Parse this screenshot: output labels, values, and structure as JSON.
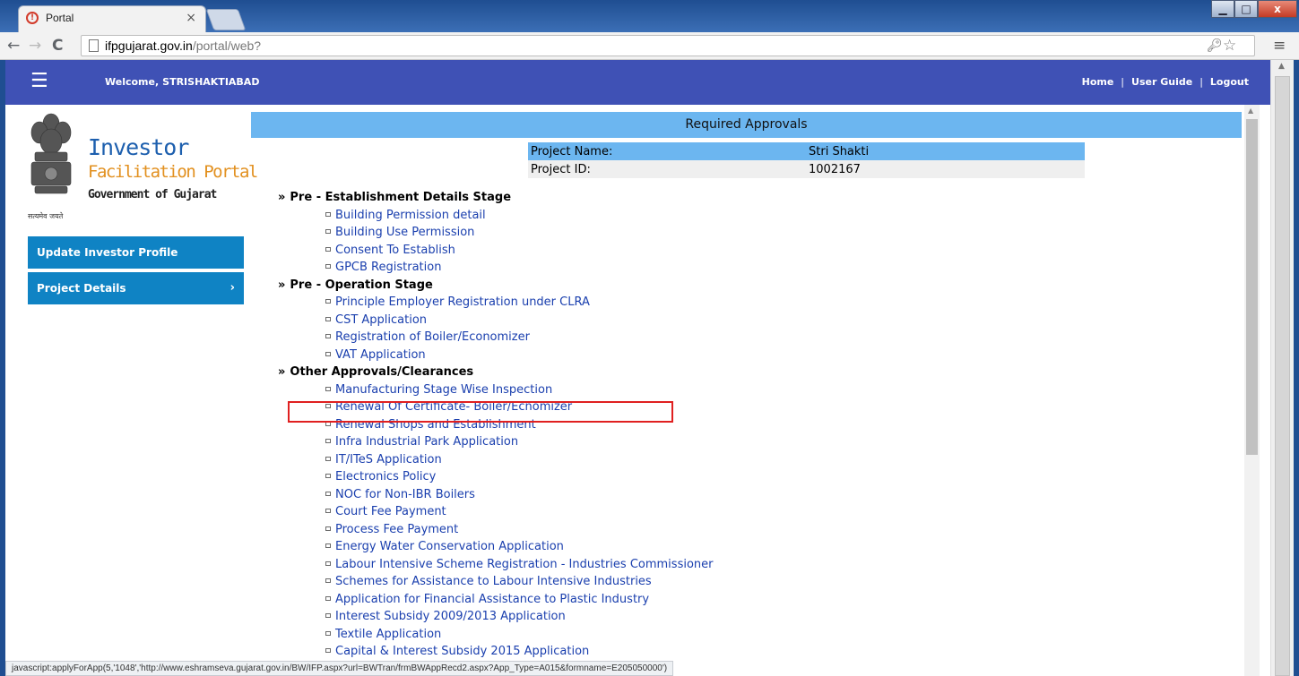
{
  "browser": {
    "tab_title": "Portal",
    "tab_close": "×",
    "url_host": "ifpgujarat.gov.in",
    "url_path": "/portal/web?",
    "win_min": "▁",
    "win_max": "□",
    "win_close": "x"
  },
  "header": {
    "welcome_label": "Welcome,",
    "username": "STRISHAKTIABAD",
    "nav": {
      "home": "Home",
      "user_guide": "User Guide",
      "logout": "Logout",
      "separator": "|"
    }
  },
  "logo": {
    "line1": "Investor",
    "line2": "Facilitation Portal",
    "line3": "Government of Gujarat",
    "motto": "सत्यमेव जयते"
  },
  "sidebar": {
    "items": [
      {
        "label": "Update Investor Profile"
      },
      {
        "label": "Project Details",
        "chevron": "›"
      }
    ]
  },
  "main": {
    "title": "Required Approvals",
    "project": {
      "name_label": "Project Name:",
      "name_value": "Stri Shakti",
      "id_label": "Project ID:",
      "id_value": "1002167"
    },
    "stages": [
      {
        "heading": "Pre - Establishment Details Stage",
        "items": [
          "Building Permission detail",
          "Building Use Permission",
          "Consent To Establish",
          "GPCB Registration"
        ]
      },
      {
        "heading": "Pre - Operation Stage",
        "items": [
          "Principle Employer Registration under CLRA",
          "CST Application",
          "Registration of Boiler/Economizer",
          "VAT Application"
        ]
      },
      {
        "heading": "Other Approvals/Clearances",
        "items": [
          "Manufacturing Stage Wise Inspection",
          "Renewal Of Certificate- Boiler/Ecnomizer",
          "Renewal Shops and Establishment",
          "Infra Industrial Park Application",
          "IT/ITeS Application",
          "Electronics Policy",
          "NOC for Non-IBR Boilers",
          "Court Fee Payment",
          "Process Fee Payment",
          "Energy Water Conservation Application",
          "Labour Intensive Scheme Registration - Industries Commissioner",
          "Schemes for Assistance to Labour Intensive Industries",
          "Application for Financial Assistance to Plastic Industry",
          "Interest Subsidy 2009/2013 Application",
          "Textile Application",
          "Capital & Interest Subsidy 2015 Application"
        ]
      }
    ]
  },
  "status_bar": "javascript:applyForApp(5,'1048','http://www.eshramseva.gujarat.gov.in/BW/IFP.aspx?url=BWTran/frmBWAppRecd2.aspx?App_Type=A015&formname=E205050000')",
  "colors": {
    "header_bg": "#3f51b5",
    "sidebar_bg": "#0f83c4",
    "title_bar_bg": "#6cb6f0",
    "link": "#1a3fae",
    "highlight_border": "#e02020"
  }
}
